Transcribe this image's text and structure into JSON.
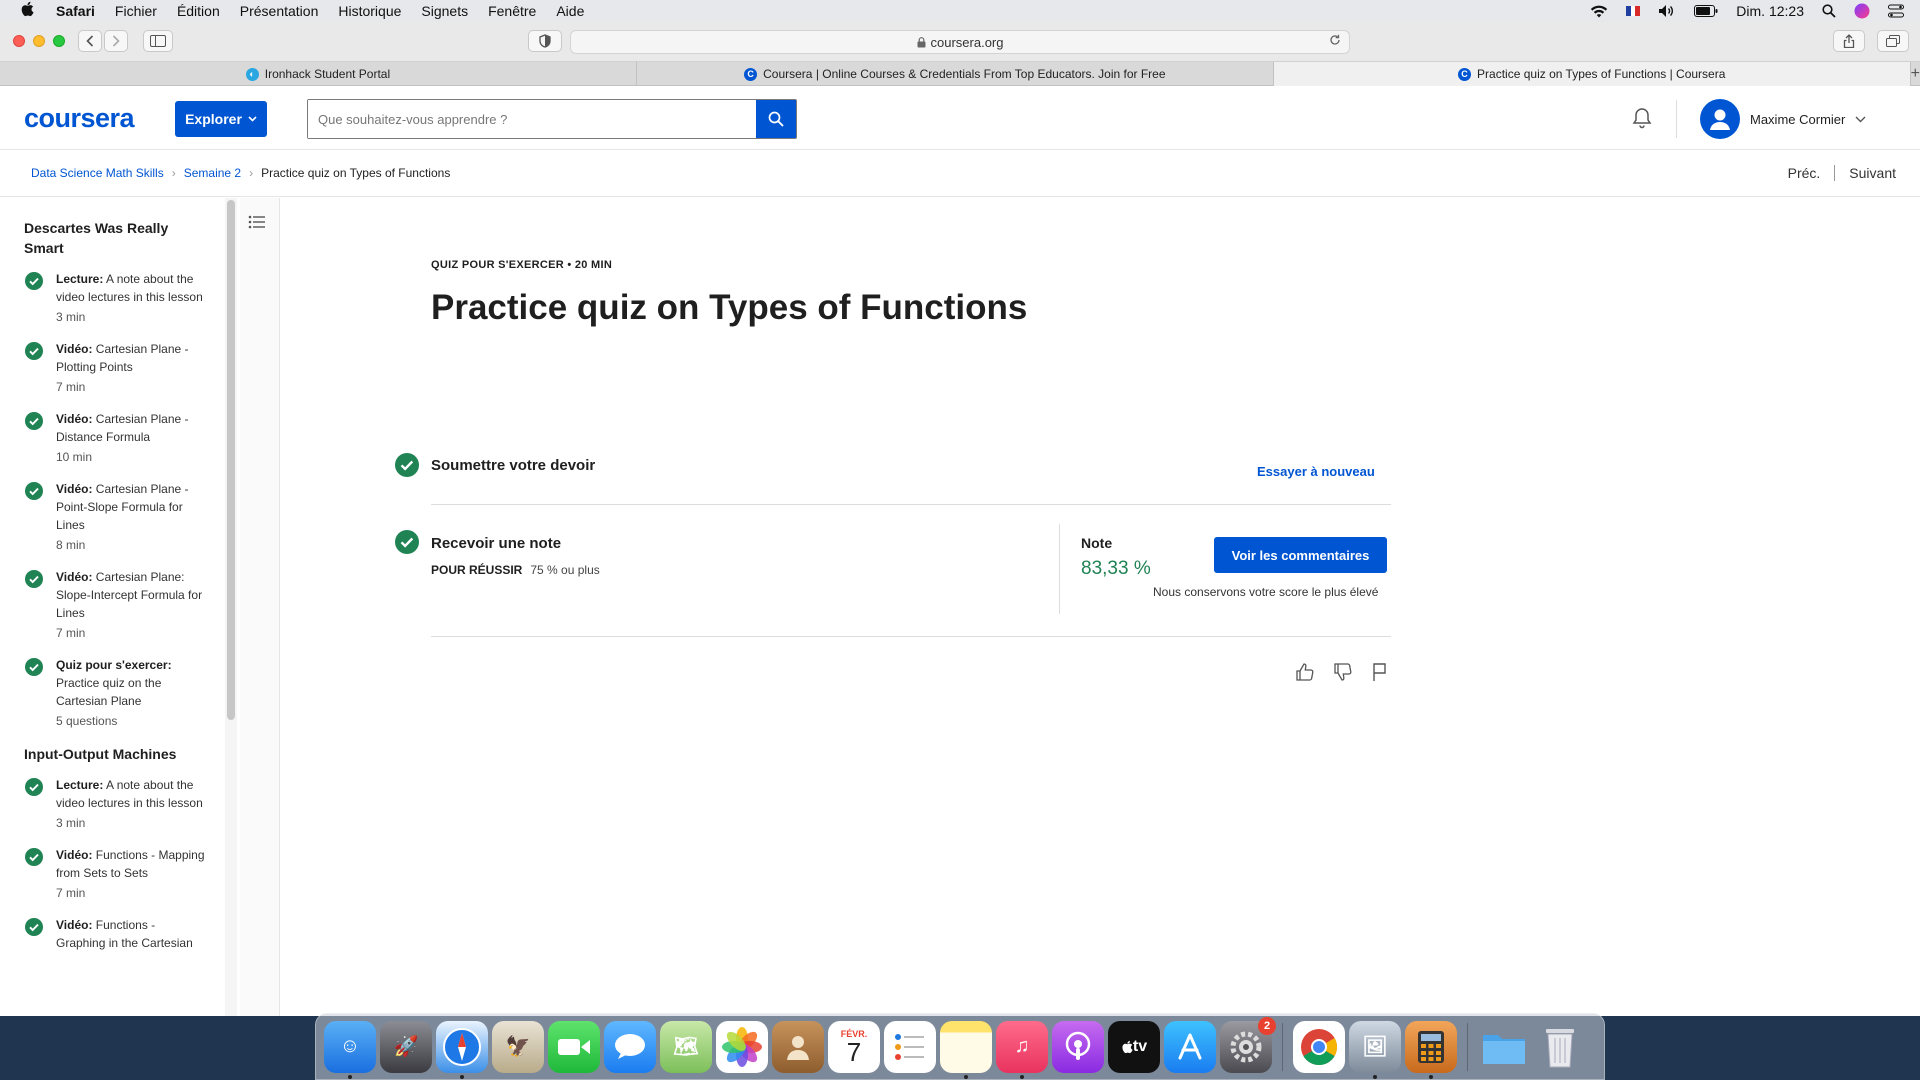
{
  "menubar": {
    "app": "Safari",
    "items": [
      "Fichier",
      "Édition",
      "Présentation",
      "Historique",
      "Signets",
      "Fenêtre",
      "Aide"
    ],
    "datetime": "Dim. 12:23"
  },
  "browser": {
    "url": "coursera.org",
    "tabs": [
      {
        "title": "Ironhack Student Portal",
        "active": false
      },
      {
        "title": "Coursera | Online Courses & Credentials From Top Educators. Join for Free",
        "active": false
      },
      {
        "title": "Practice quiz on Types of Functions | Coursera",
        "active": true
      }
    ]
  },
  "header": {
    "logo": "coursera",
    "explore_label": "Explorer",
    "search_placeholder": "Que souhaitez-vous apprendre ?",
    "user_name": "Maxime Cormier"
  },
  "breadcrumb": {
    "items": [
      "Data Science Math Skills",
      "Semaine 2"
    ],
    "current": "Practice quiz on Types of Functions",
    "prev": "Préc.",
    "next": "Suivant"
  },
  "sidebar": {
    "modules": [
      {
        "title": "Descartes Was Really Smart",
        "items": [
          {
            "type": "Lecture:",
            "title": "A note about the video lectures in this lesson",
            "duration": "3 min"
          },
          {
            "type": "Vidéo:",
            "title": "Cartesian Plane - Plotting Points",
            "duration": "7 min"
          },
          {
            "type": "Vidéo:",
            "title": "Cartesian Plane - Distance Formula",
            "duration": "10 min"
          },
          {
            "type": "Vidéo:",
            "title": "Cartesian Plane - Point-Slope Formula for Lines",
            "duration": "8 min"
          },
          {
            "type": "Vidéo:",
            "title": "Cartesian Plane: Slope-Intercept Formula for Lines",
            "duration": "7 min"
          },
          {
            "type": "Quiz pour s'exercer:",
            "title": "Practice quiz on the Cartesian Plane",
            "duration": "5 questions"
          }
        ]
      },
      {
        "title": "Input-Output Machines",
        "items": [
          {
            "type": "Lecture:",
            "title": "A note about the video lectures in this lesson",
            "duration": "3 min"
          },
          {
            "type": "Vidéo:",
            "title": "Functions - Mapping from Sets to Sets",
            "duration": "7 min"
          },
          {
            "type": "Vidéo:",
            "title": "Functions - Graphing in the Cartesian",
            "duration": ""
          }
        ]
      }
    ]
  },
  "quiz": {
    "kicker": "QUIZ POUR S'EXERCER • 20 MIN",
    "title": "Practice quiz on Types of Functions",
    "step_submit": "Soumettre votre devoir",
    "retry_label": "Essayer à nouveau",
    "step_grade": "Recevoir une note",
    "pass_label": "POUR RÉUSSIR",
    "pass_value": "75 % ou plus",
    "grade_label": "Note",
    "grade_value": "83,33 %",
    "feedback_button": "Voir les commentaires",
    "keep_note": "Nous conservons votre score le plus élevé"
  },
  "colors": {
    "brand": "#0056d2",
    "success": "#1f8354"
  },
  "dock": {
    "calendar_month": "FÉVR.",
    "calendar_day": "7",
    "settings_badge": "2",
    "appletv_label": "tv"
  }
}
